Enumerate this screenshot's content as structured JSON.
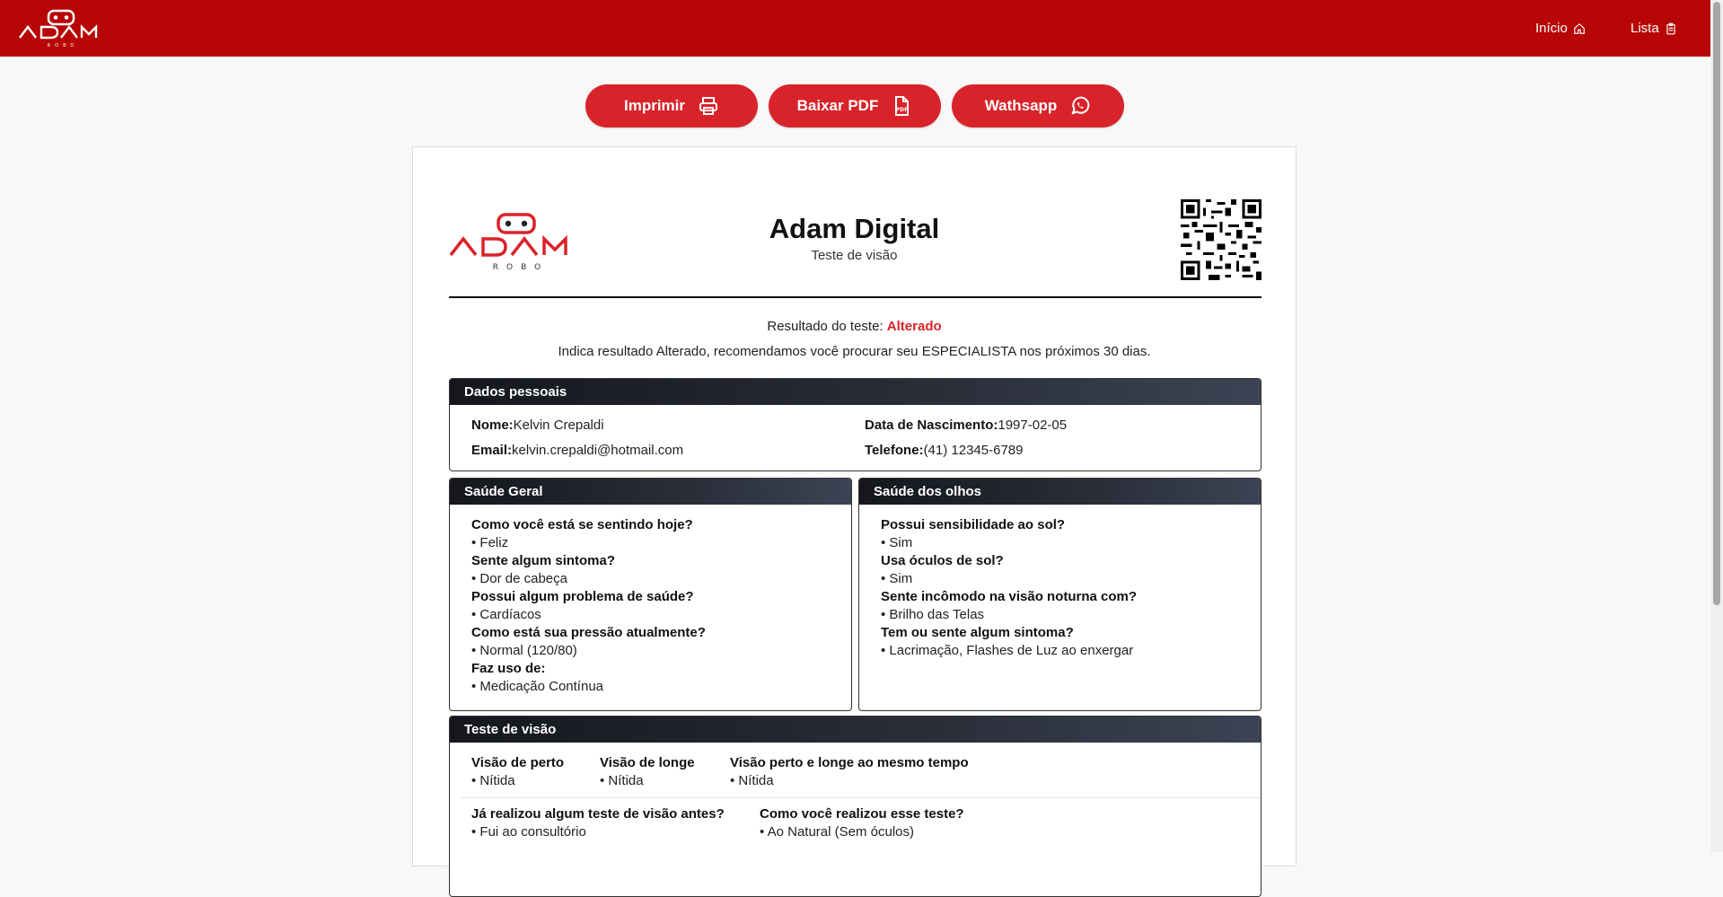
{
  "topbar": {
    "brand": "ADAM ROBO",
    "nav": [
      {
        "label": "Início",
        "icon": "home-icon"
      },
      {
        "label": "Lista",
        "icon": "clipboard-icon"
      }
    ]
  },
  "actions": [
    {
      "label": "Imprimir",
      "icon": "printer-icon"
    },
    {
      "label": "Baixar PDF",
      "icon": "pdf-icon"
    },
    {
      "label": "Wathsapp",
      "icon": "whatsapp-icon"
    }
  ],
  "report": {
    "title": "Adam Digital",
    "subtitle": "Teste de visão",
    "result_label": "Resultado do teste:",
    "result_value": "Alterado",
    "recommendation": "Indica resultado Alterado, recomendamos você procurar seu ESPECIALISTA nos próximos 30 dias.",
    "personal": {
      "title": "Dados pessoais",
      "name_label": "Nome:",
      "name": "Kelvin Crepaldi",
      "birth_label": "Data de Nascimento:",
      "birth": "1997-02-05",
      "email_label": "Email:",
      "email": "kelvin.crepaldi@hotmail.com",
      "phone_label": "Telefone:",
      "phone": "(41) 12345-6789"
    },
    "general_health": {
      "title": "Saúde Geral",
      "items": [
        {
          "q": "Como você está se sentindo hoje?",
          "a": "• Feliz"
        },
        {
          "q": "Sente algum sintoma?",
          "a": "• Dor de cabeça"
        },
        {
          "q": "Possui algum problema de saúde?",
          "a": "• Cardíacos"
        },
        {
          "q": "Como está sua pressão atualmente?",
          "a": "• Normal (120/80)"
        },
        {
          "q": "Faz uso de:",
          "a": "• Medicação Contínua"
        }
      ]
    },
    "eye_health": {
      "title": "Saúde dos olhos",
      "items": [
        {
          "q": "Possui sensibilidade ao sol?",
          "a": "• Sim"
        },
        {
          "q": "Usa óculos de sol?",
          "a": "• Sim"
        },
        {
          "q": "Sente incômodo na visão noturna com?",
          "a": "• Brilho das Telas"
        },
        {
          "q": "Tem ou sente algum sintoma?",
          "a": "• Lacrimação, Flashes de Luz ao enxergar"
        }
      ]
    },
    "vision_test": {
      "title": "Teste de visão",
      "row1": [
        {
          "q": "Visão de perto",
          "a": "• Nítida"
        },
        {
          "q": "Visão de longe",
          "a": "• Nítida"
        },
        {
          "q": "Visão perto e longe ao mesmo tempo",
          "a": "• Nítida"
        }
      ],
      "row2": [
        {
          "q": "Já realizou algum teste de visão antes?",
          "a": "• Fui ao consultório"
        },
        {
          "q": "Como você realizou esse teste?",
          "a": "• Ao Natural (Sem óculos)"
        }
      ]
    }
  },
  "colors": {
    "brand_red": "#b80505",
    "button_red": "#d9232a",
    "header_dark": "#1f222a"
  }
}
